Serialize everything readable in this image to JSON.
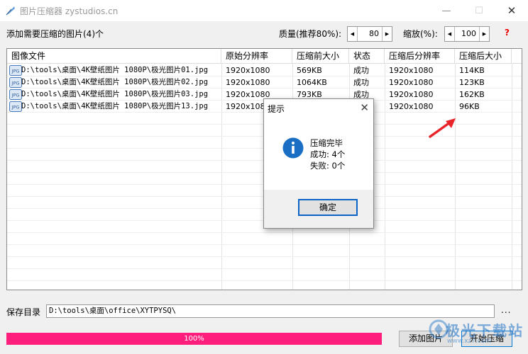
{
  "window": {
    "title": "图片压缩器 zystudios.cn",
    "minimize_glyph": "—",
    "maximize_glyph": "☐",
    "close_glyph": "✕"
  },
  "toolbar": {
    "add_count_label": "添加需要压缩的图片(4)个",
    "quality_label": "质量(推荐80%):",
    "quality_value": "80",
    "scale_label": "缩放(%):",
    "scale_value": "100",
    "help_label": "?"
  },
  "table": {
    "headers": [
      "图像文件",
      "原始分辨率",
      "压缩前大小",
      "状态",
      "压缩后分辨率",
      "压缩后大小"
    ],
    "rows": [
      {
        "icon_label": "JPG",
        "file": "D:\\tools\\桌面\\4K壁纸图片 1080P\\极光图片01.jpg",
        "orig_res": "1920x1080",
        "before_size": "569KB",
        "status": "成功",
        "after_res": "1920x1080",
        "after_size": "114KB"
      },
      {
        "icon_label": "JPG",
        "file": "D:\\tools\\桌面\\4K壁纸图片 1080P\\极光图片02.jpg",
        "orig_res": "1920x1080",
        "before_size": "1064KB",
        "status": "成功",
        "after_res": "1920x1080",
        "after_size": "123KB"
      },
      {
        "icon_label": "JPG",
        "file": "D:\\tools\\桌面\\4K壁纸图片 1080P\\极光图片03.jpg",
        "orig_res": "1920x1080",
        "before_size": "793KB",
        "status": "成功",
        "after_res": "1920x1080",
        "after_size": "162KB"
      },
      {
        "icon_label": "JPG",
        "file": "D:\\tools\\桌面\\4K壁纸图片 1080P\\极光图片13.jpg",
        "orig_res": "1920x1080",
        "before_size": "",
        "status": "",
        "after_res": "1920x1080",
        "after_size": "96KB"
      }
    ]
  },
  "dialog": {
    "title": "提示",
    "close_glyph": "✕",
    "icon": "info-icon",
    "message_title": "压缩完毕",
    "success_line": "成功: 4个",
    "fail_line": "失败: 0个",
    "ok_label": "确定"
  },
  "save": {
    "label": "保存目录",
    "path": "D:\\tools\\桌面\\office\\XYTPYSQ\\",
    "browse_label": "..."
  },
  "progress": {
    "percent": 100,
    "text": "100%",
    "fill_color": "#ff1e7c"
  },
  "actions": {
    "add_label": "添加图片",
    "start_label": "开始压缩"
  },
  "watermark": {
    "line1": "极光下载站",
    "line2": "www.xz7.com"
  },
  "colors": {
    "accent": "#0a64c8",
    "help": "#e00000",
    "annotation_arrow": "#e8232a"
  }
}
